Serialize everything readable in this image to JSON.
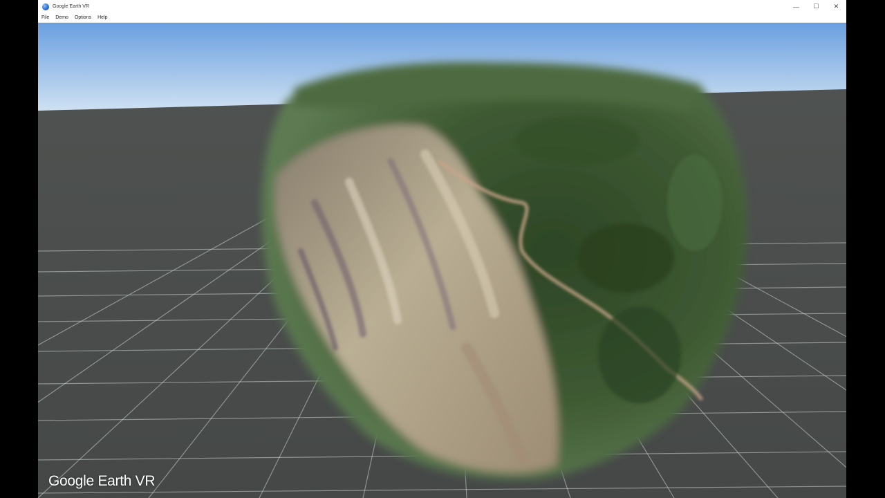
{
  "window": {
    "title": "Google Earth VR",
    "controls": [
      "—",
      "☐",
      "✕"
    ]
  },
  "menu": {
    "items": [
      "File",
      "Demo",
      "Options",
      "Help"
    ]
  },
  "brand": {
    "text": "Google Earth VR"
  },
  "colors": {
    "sky_top": "#6a9fe0",
    "sky_bottom": "#cfe1f2",
    "ground": "#4a4d4c",
    "grid_line": "#c9d2d0",
    "forest": "#3e5a32",
    "cliff": "#b8ab93"
  }
}
